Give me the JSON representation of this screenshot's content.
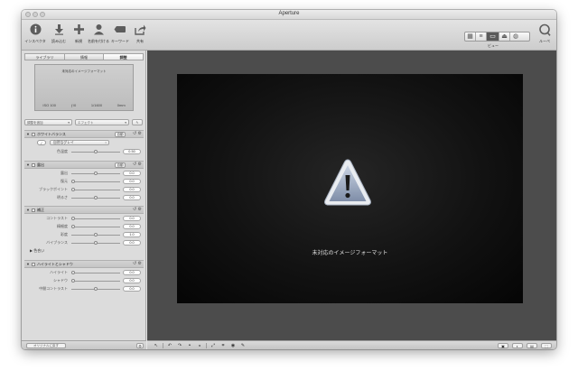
{
  "window": {
    "title": "Aperture"
  },
  "toolbar": {
    "inspector": {
      "label": "インスペクタ",
      "icon": "info-icon"
    },
    "import": {
      "label": "読み込む",
      "icon": "import-icon"
    },
    "new": {
      "label": "新規",
      "icon": "add-icon"
    },
    "faces": {
      "label": "名前を付ける",
      "icon": "person-icon"
    },
    "keywords": {
      "label": "キーワード",
      "icon": "keyword-tag-icon"
    },
    "share": {
      "label": "共有",
      "icon": "share-icon"
    },
    "view_label": "ビュー",
    "loupe_label": "ルーペ"
  },
  "sidebar": {
    "tabs": [
      "ライブラリ",
      "情報",
      "調整"
    ],
    "active_tab": 2,
    "preview": {
      "message": "未対応のイメージフォーマット",
      "iso": "ISO 100",
      "aperture": "ƒ/0",
      "shutter": "1/1600",
      "focal": "0mm"
    },
    "presets_select": "調整を追加",
    "effects_select": "エフェクト"
  },
  "white_balance": {
    "title": "ホワイトバランス",
    "auto_label": "自動",
    "mode": "自然なグレイ",
    "rows": [
      {
        "label": "色温度",
        "value": "0.50",
        "level": 0.5
      }
    ]
  },
  "exposure": {
    "title": "露出",
    "auto_label": "自動",
    "rows": [
      {
        "label": "露出",
        "value": "0.0",
        "level": 0.5
      },
      {
        "label": "復元",
        "value": "0.0",
        "level": 0.0
      },
      {
        "label": "ブラックポイント",
        "value": "0.0",
        "level": 0.0
      },
      {
        "label": "明るさ",
        "value": "0.0",
        "level": 0.5
      }
    ]
  },
  "enhance": {
    "title": "補正",
    "rows": [
      {
        "label": "コントラスト",
        "value": "0.0",
        "level": 0.0
      },
      {
        "label": "精細度",
        "value": "0.0",
        "level": 0.0
      },
      {
        "label": "彩度",
        "value": "1.0",
        "level": 0.5
      },
      {
        "label": "バイブランス",
        "value": "0.0",
        "level": 0.5
      }
    ],
    "tint_label": "色合い"
  },
  "highlights_shadows": {
    "title": "ハイライトとシャドウ",
    "rows": [
      {
        "label": "ハイライト",
        "value": "0.0",
        "level": 0.0
      },
      {
        "label": "シャドウ",
        "value": "0.0",
        "level": 0.0
      },
      {
        "label": "中間コントラスト",
        "value": "0.0",
        "level": 0.5
      }
    ]
  },
  "sidebar_bottom": {
    "revert_label": "オリジナルに戻す"
  },
  "viewer": {
    "message": "未対応のイメージフォーマット"
  },
  "colors": {
    "viewer_bg": "#4c4c4c",
    "canvas_bg": "#111111",
    "accent_dark": "#5a5a5a"
  }
}
